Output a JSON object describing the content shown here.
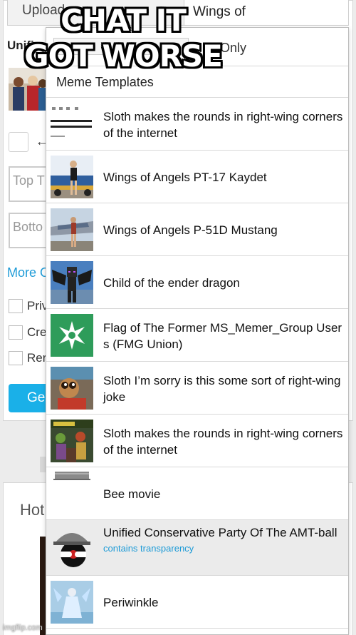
{
  "caption": {
    "line1": "CHAT IT",
    "line2": "GOT WORSE"
  },
  "background": {
    "upload_tab": "Upload",
    "search_value": "Wings of",
    "unified_label": "Unifie",
    "top_text_placeholder": "Top T",
    "bottom_text_placeholder": "Botto",
    "more_options": "More O",
    "checkboxes": [
      "Priv",
      "Cre",
      "Rer"
    ],
    "generate_label": "Ge",
    "hot_label": "Hot"
  },
  "dropdown": {
    "filter_label": "GIFs Only",
    "section_label": "Meme Templates",
    "items": [
      {
        "title": "Sloth makes the rounds in right-wing corners of the internet",
        "subtitle": "",
        "icon": "news-screenshot-thumb"
      },
      {
        "title": "Wings of Angels PT-17 Kaydet",
        "subtitle": "",
        "icon": "biplane-pinup-thumb"
      },
      {
        "title": "Wings of Angels P-51D Mustang",
        "subtitle": "",
        "icon": "mustang-pinup-thumb"
      },
      {
        "title": "Child of the ender dragon",
        "subtitle": "",
        "icon": "minecraft-dragon-thumb"
      },
      {
        "title": "Flag of The Former MS_Memer_Group Users (FMG Union)",
        "subtitle": "",
        "icon": "green-flag-thumb"
      },
      {
        "title": "Sloth I’m sorry is this some sort of right-wing joke",
        "subtitle": "",
        "icon": "sloth-thumb"
      },
      {
        "title": "Sloth makes the rounds in right-wing corners of the internet",
        "subtitle": "",
        "icon": "comic-collage-thumb"
      },
      {
        "title": "Bee movie",
        "subtitle": "",
        "icon": "bee-movie-thumb"
      },
      {
        "title": "Unified Conservative Party Of The AMT-ball",
        "subtitle": "contains transparency",
        "icon": "countryball-thumb"
      },
      {
        "title": "Periwinkle",
        "subtitle": "",
        "icon": "periwinkle-thumb"
      }
    ]
  },
  "watermark": "imgflip.com",
  "colors": {
    "accent": "#1e9bd7",
    "button": "#1ab0e8",
    "selected_row": "#ebebeb"
  }
}
